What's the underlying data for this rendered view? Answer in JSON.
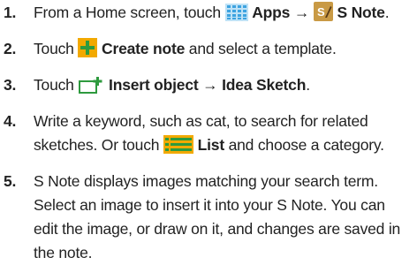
{
  "steps": [
    {
      "num": "1.",
      "pre": "From a Home screen, touch ",
      "icon1": "apps-grid-icon",
      "b1": "Apps",
      "arrow": " → ",
      "icon2": "s-note-app-icon",
      "b2": "S Note",
      "post": "."
    },
    {
      "num": "2.",
      "pre": "Touch ",
      "icon1": "plus-icon",
      "b1": "Create note",
      "post": " and select a template."
    },
    {
      "num": "3.",
      "pre": "Touch ",
      "icon1": "insert-object-icon",
      "b1": "Insert object",
      "arrow": " → ",
      "b2": "Idea Sketch",
      "post": "."
    },
    {
      "num": "4.",
      "line1": "Write a keyword, such as cat, to search for related",
      "pre": "sketches. Or touch ",
      "icon1": "list-icon",
      "b1": "List",
      "post": " and choose a category."
    },
    {
      "num": "5.",
      "lines": [
        "S Note displays images matching your search term.",
        "Select an image to insert it into your S Note. You can",
        "edit the image, or draw on it, and changes are saved in",
        "the note."
      ]
    }
  ],
  "colors": {
    "apps_icon": "#3da3e0",
    "snote_bg": "#c99a45",
    "plus_bg": "#f2a900",
    "plus_mark": "#2e9a3e",
    "insert_icon": "#2e9a3e",
    "list_bg": "#f2a900"
  }
}
